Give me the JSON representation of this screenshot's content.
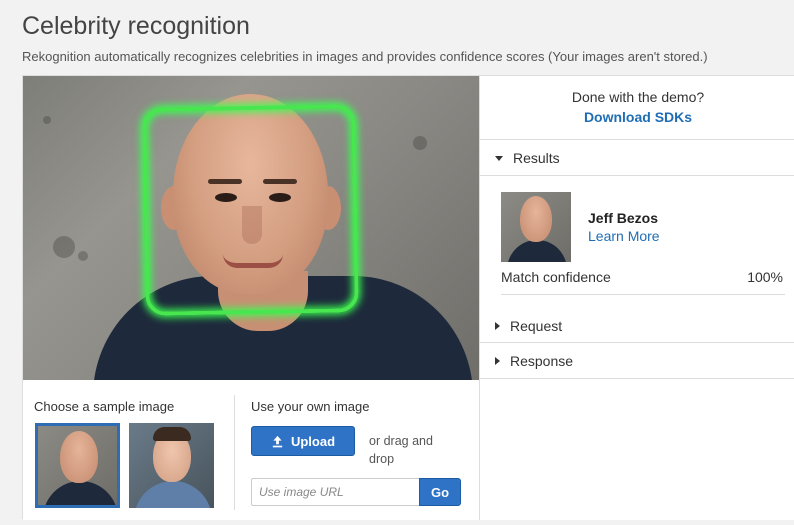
{
  "header": {
    "title": "Celebrity recognition",
    "subtitle": "Rekognition automatically recognizes celebrities in images and provides confidence scores (Your images aren't stored.)"
  },
  "chooser": {
    "sample_label": "Choose a sample image",
    "own_label": "Use your own image",
    "upload_label": "Upload",
    "drag_text": "or drag and drop",
    "url_placeholder": "Use image URL",
    "go_label": "Go"
  },
  "results_pane": {
    "cta_text": "Done with the demo?",
    "cta_link": "Download SDKs",
    "sections": [
      {
        "label": "Results",
        "expanded": true
      },
      {
        "label": "Request",
        "expanded": false
      },
      {
        "label": "Response",
        "expanded": false
      }
    ],
    "celebrity": {
      "name": "Jeff Bezos",
      "link": "Learn More",
      "match_label": "Match confidence",
      "match_value": "100%"
    }
  },
  "colors": {
    "accent": "#2e73c6",
    "link": "#1f6eb5",
    "face_box": "#48e64f"
  },
  "icons": [
    "upload-icon",
    "caret-down-icon",
    "caret-right-icon"
  ]
}
